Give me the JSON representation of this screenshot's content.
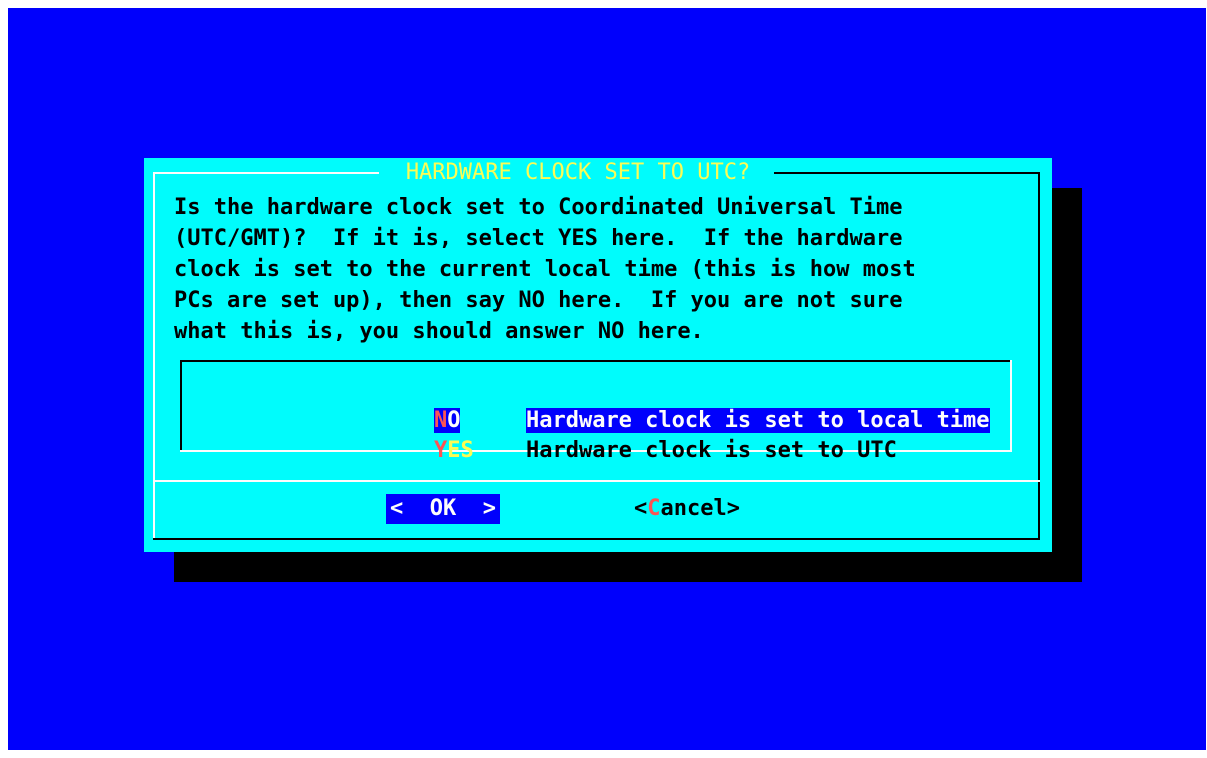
{
  "dialog": {
    "title": "HARDWARE CLOCK SET TO UTC?",
    "prompt": "Is the hardware clock set to Coordinated Universal Time\n(UTC/GMT)?  If it is, select YES here.  If the hardware\nclock is set to the current local time (this is how most\nPCs are set up), then say NO here.  If you are not sure\nwhat this is, you should answer NO here."
  },
  "menu": {
    "items": [
      {
        "tag_hot": "N",
        "tag_rest": "O",
        "description": "Hardware clock is set to local time",
        "selected": true
      },
      {
        "tag_hot": "Y",
        "tag_rest": "ES",
        "description": "Hardware clock is set to UTC",
        "selected": false
      }
    ]
  },
  "buttons": {
    "ok_label": "<  OK  >",
    "cancel_open": "<",
    "cancel_hot": "C",
    "cancel_rest": "ancel",
    "cancel_close": ">"
  },
  "colors": {
    "screen_bg": "#0000fc",
    "dialog_bg": "#00fcfc",
    "title_color": "#fcfc54",
    "hotkey_color": "#fc5454",
    "shadow": "#000000"
  }
}
